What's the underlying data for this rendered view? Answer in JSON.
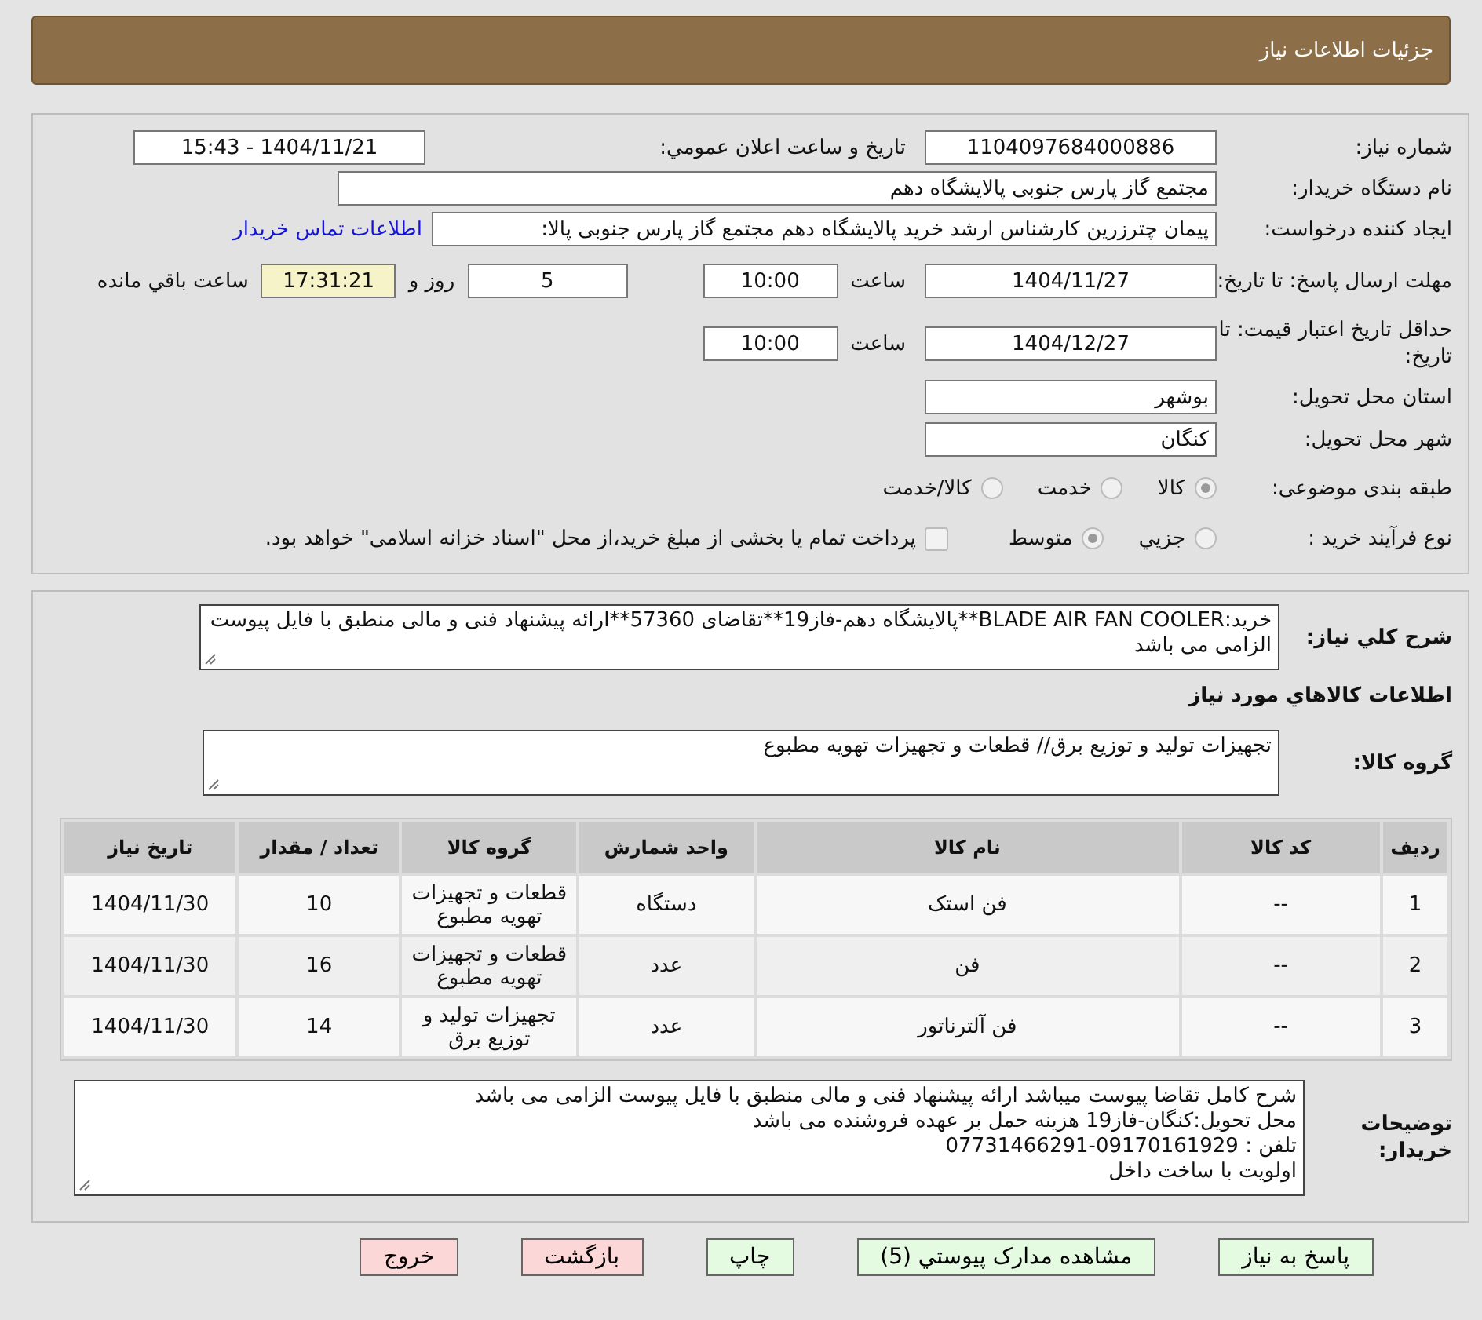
{
  "header": {
    "title": "جزئیات اطلاعات نیاز"
  },
  "need_number": {
    "label": "شماره نیاز:",
    "value": "1104097684000886"
  },
  "announce": {
    "label": "تاریخ و ساعت اعلان عمومي:",
    "value": "1404/11/21 - 15:43"
  },
  "buyer_org": {
    "label": "نام دستگاه خریدار:",
    "value": "مجتمع گاز پارس جنوبی  پالایشگاه دهم"
  },
  "requester": {
    "label": "ایجاد کننده درخواست:",
    "value": "پیمان چترزرین کارشناس ارشد خرید پالایشگاه دهم مجتمع گاز پارس جنوبی  پالا:",
    "contact_link": "اطلاعات تماس خریدار"
  },
  "deadline": {
    "label": "مهلت ارسال پاسخ: تا تاریخ:",
    "date": "1404/11/27",
    "time_label": "ساعت",
    "time": "10:00",
    "days": "5",
    "days_suffix": "روز و",
    "remaining": "17:31:21",
    "remaining_suffix": "ساعت باقي مانده"
  },
  "validity": {
    "label": "حداقل تاریخ اعتبار قیمت: تا تاریخ:",
    "date": "1404/12/27",
    "time_label": "ساعت",
    "time": "10:00"
  },
  "province": {
    "label": "استان محل تحویل:",
    "value": "بوشهر"
  },
  "city": {
    "label": "شهر محل تحویل:",
    "value": "کنگان"
  },
  "category": {
    "label": "طبقه بندی موضوعی:",
    "options": [
      {
        "label": "کالا",
        "selected": true
      },
      {
        "label": "خدمت",
        "selected": false
      },
      {
        "label": "کالا/خدمت",
        "selected": false
      }
    ]
  },
  "process": {
    "label": "نوع فرآیند خرید :",
    "options": [
      {
        "label": "جزيي",
        "selected": false
      },
      {
        "label": "متوسط",
        "selected": true
      }
    ],
    "checkbox": {
      "checked": false,
      "label": "پرداخت تمام یا بخشی از مبلغ خرید،از محل \"اسناد خزانه اسلامی\" خواهد بود."
    }
  },
  "description": {
    "label": "شرح کلي نياز:",
    "value": "خرید:BLADE AIR FAN COOLER**پالایشگاه دهم-فاز19**تقاضای 57360**ارائه پیشنهاد فنی و مالی منطبق با فایل پیوست الزامی می باشد"
  },
  "goods_heading": "اطلاعات كالاهاي مورد نياز",
  "goods_group": {
    "label": "گروه کالا:",
    "value": "تجهیزات تولید و توزیع برق//  قطعات و تجهیزات تهویه مطبوع"
  },
  "table": {
    "columns": [
      "رديف",
      "کد کالا",
      "نام کالا",
      "واحد شمارش",
      "گروه کالا",
      "تعداد / مقدار",
      "تاریخ نیاز"
    ],
    "rows": [
      [
        "1",
        "--",
        "فن استک",
        "دستگاه",
        "قطعات و تجهیزات تهویه مطبوع",
        "10",
        "1404/11/30"
      ],
      [
        "2",
        "--",
        "فن",
        "عدد",
        "قطعات و تجهیزات تهویه مطبوع",
        "16",
        "1404/11/30"
      ],
      [
        "3",
        "--",
        "فن آلترناتور",
        "عدد",
        "تجهیزات تولید و توزیع برق",
        "14",
        "1404/11/30"
      ]
    ]
  },
  "buyer_notes": {
    "label": "توضیحات خریدار:",
    "lines": [
      "شرح کامل تقاضا پیوست میباشد ارائه پیشنهاد فنی و مالی منطبق با فایل پیوست الزامی می باشد",
      "محل تحویل:کنگان-فاز19 هزینه حمل بر عهده فروشنده می باشد",
      "تلفن : 09170161929-07731466291",
      "اولویت با ساخت داخل"
    ]
  },
  "buttons": [
    {
      "label": "پاسخ به نیاز",
      "kind": "green"
    },
    {
      "label": "مشاهده مدارک پیوستي (5)",
      "kind": "green"
    },
    {
      "label": "چاپ",
      "kind": "green"
    },
    {
      "label": "بازگشت",
      "kind": "red"
    },
    {
      "label": "خروج",
      "kind": "red"
    }
  ]
}
